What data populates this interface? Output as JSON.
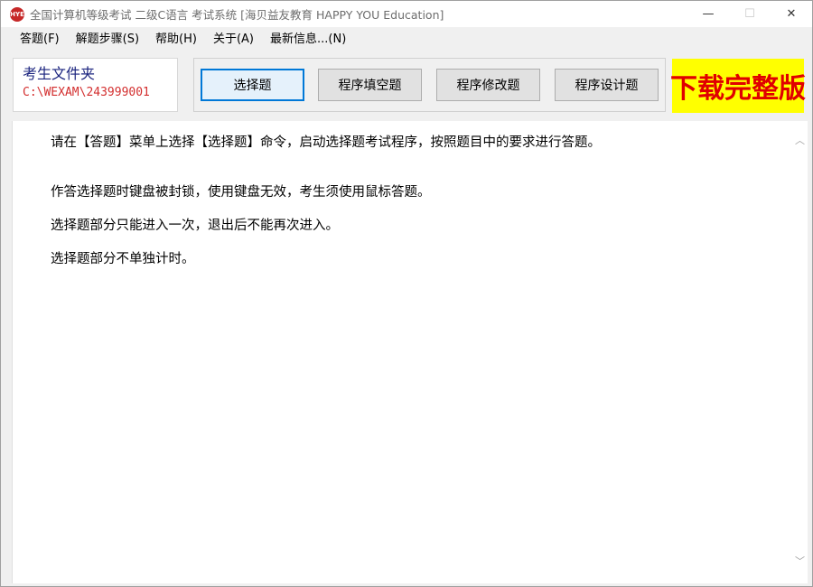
{
  "window": {
    "icon_text": "HYE",
    "title": "全国计算机等级考试 二级C语言 考试系统 [海贝益友教育 HAPPY YOU Education]",
    "minimize": "—",
    "maximize": "☐",
    "close": "✕"
  },
  "menu": {
    "items": [
      {
        "label": "答题(F)"
      },
      {
        "label": "解题步骤(S)"
      },
      {
        "label": "帮助(H)"
      },
      {
        "label": "关于(A)"
      },
      {
        "label": "最新信息...(N)"
      }
    ]
  },
  "folder": {
    "label": "考生文件夹",
    "path": "C:\\WEXAM\\243999001"
  },
  "toolbar": {
    "buttons": [
      {
        "label": "选择题",
        "active": true
      },
      {
        "label": "程序填空题",
        "active": false
      },
      {
        "label": "程序修改题",
        "active": false
      },
      {
        "label": "程序设计题",
        "active": false
      }
    ],
    "download_label": "下载完整版"
  },
  "content": {
    "lines": [
      "请在【答题】菜单上选择【选择题】命令，启动选择题考试程序，按照题目中的要求进行答题。",
      "作答选择题时键盘被封锁，使用键盘无效，考生须使用鼠标答题。",
      "选择题部分只能进入一次，退出后不能再次进入。",
      "选择题部分不单独计时。"
    ]
  },
  "scrollbar": {
    "up": "︿",
    "down": "﹀"
  }
}
